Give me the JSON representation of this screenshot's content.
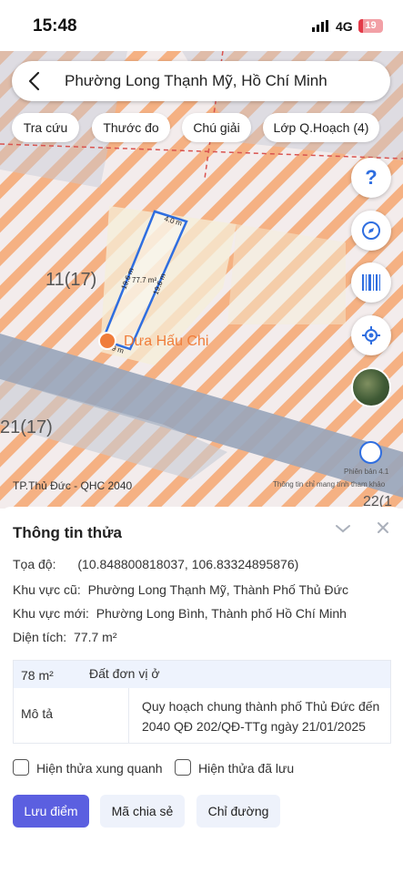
{
  "status_bar": {
    "time": "15:48",
    "network": "4G",
    "battery": "19",
    "battery_level": 0.19,
    "icons": [
      "signal-bars-icon",
      "battery-icon"
    ]
  },
  "search": {
    "title": "Phường Long Thạnh Mỹ, Hồ Chí Minh",
    "icon": "back-chevron-icon"
  },
  "chips": [
    "Tra cứu",
    "Thước đo",
    "Chú giải",
    "Lớp Q.Hoạch (4)"
  ],
  "map": {
    "parcel_labels": [
      "11(17)",
      "21(17)",
      "22(1"
    ],
    "edge_labels": [
      "4.0 m",
      "19.6 m",
      "19.6 m",
      "77.7 m²",
      "3.9 m"
    ],
    "poi": "Dưa Hấu Chi",
    "footer": "TP.Thủ Đức - QHC 2040",
    "version": "Phiên bản 4.1",
    "note": "Thông tin chỉ mang tính tham khảo",
    "colors": {
      "hatch": "#f5b183",
      "zone": "#f3e8d0",
      "road": "#99a5bb",
      "parcel_outline": "#2f6ee0",
      "boundary": "#d9534f"
    },
    "buttons": [
      "help-icon",
      "compass-icon",
      "barcode-icon",
      "locate-icon",
      "satellite-thumbnail"
    ]
  },
  "info": {
    "title": "Thông tin thửa",
    "coord_label": "Tọa độ:",
    "coord_value": "(10.848800818037, 106.83324895876)",
    "old_area_label": "Khu vực cũ:",
    "old_area_value": "Phường Long Thạnh Mỹ, Thành Phố Thủ Đức",
    "new_area_label": "Khu vực mới:",
    "new_area_value": "Phường Long Bình, Thành phố Hồ Chí Minh",
    "size_label": "Diện tích:",
    "size_value": "77.7 m²",
    "table": {
      "area": "78 m²",
      "landuse": "Đất đơn vị ở",
      "desc_label": "Mô tả",
      "desc_value": "Quy hoạch chung thành phố Thủ Đức đến 2040 QĐ 202/QĐ-TTg ngày 21/01/2025"
    },
    "checks": [
      "Hiện thửa xung quanh",
      "Hiện thửa đã lưu"
    ],
    "buttons": [
      "Lưu điểm",
      "Mã chia sẻ",
      "Chỉ đường"
    ]
  }
}
